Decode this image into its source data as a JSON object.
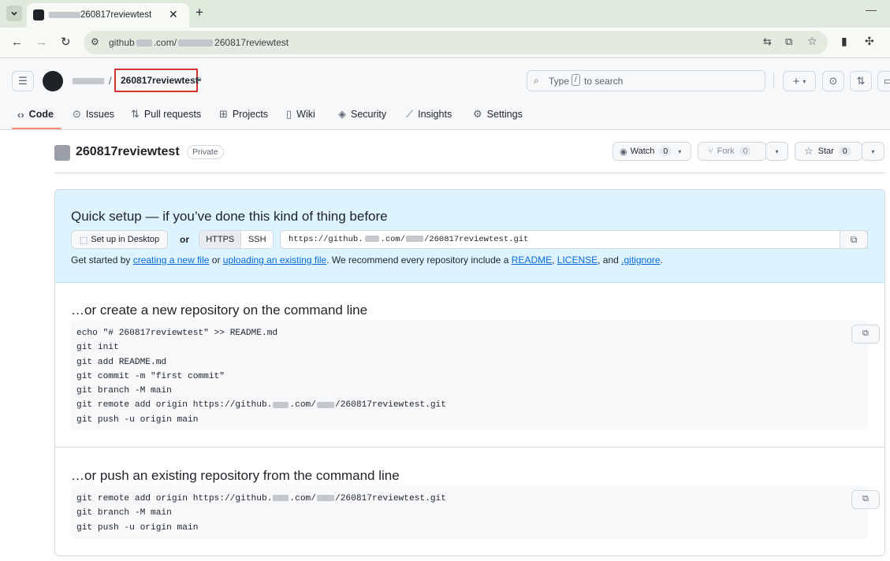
{
  "browser": {
    "tab_title": "260817reviewtest",
    "url_prefix": "github",
    "url_mid": ".com/",
    "url_suffix": "260817reviewtest"
  },
  "header": {
    "owner_sep": "/",
    "repo_name": "260817reviewtest",
    "search_prefix": "Type",
    "search_key": "/",
    "search_suffix": "to search",
    "plus": "+"
  },
  "nav": {
    "tabs": [
      {
        "label": "Code"
      },
      {
        "label": "Issues"
      },
      {
        "label": "Pull requests"
      },
      {
        "label": "Projects"
      },
      {
        "label": "Wiki"
      },
      {
        "label": "Security"
      },
      {
        "label": "Insights"
      },
      {
        "label": "Settings"
      }
    ]
  },
  "repo": {
    "name": "260817reviewtest",
    "visibility": "Private",
    "watch_label": "Watch",
    "watch_count": "0",
    "fork_label": "Fork",
    "fork_count": "0",
    "star_label": "Star",
    "star_count": "0"
  },
  "quick": {
    "title": "Quick setup — if you’ve done this kind of thing before",
    "desktop_label": "Set up in Desktop",
    "or": "or",
    "https": "HTTPS",
    "ssh": "SSH",
    "clone_prefix": "https://github.",
    "clone_mid": ".com/",
    "clone_suffix": "/260817reviewtest.git",
    "info_1": "Get started by ",
    "link_new_file": "creating a new file",
    "info_2": " or ",
    "link_upload": "uploading an existing file",
    "info_3": ". We recommend every repository include a ",
    "link_readme": "README",
    "info_4": ", ",
    "link_license": "LICENSE",
    "info_5": ", and ",
    "link_gitignore": ".gitignore",
    "info_6": "."
  },
  "create": {
    "title": "…or create a new repository on the command line",
    "lines": [
      "echo \"# 260817reviewtest\" >> README.md",
      "git init",
      "git add README.md",
      "git commit -m \"first commit\"",
      "git branch -M main"
    ],
    "remote_prefix": "git remote add origin https://github.",
    "remote_mid": ".com/",
    "remote_suffix": "/260817reviewtest.git",
    "last_line": "git push -u origin main"
  },
  "push": {
    "title": "…or push an existing repository from the command line",
    "remote_prefix": "git remote add origin https://github.",
    "remote_mid": ".com/",
    "remote_suffix": "/260817reviewtest.git",
    "lines": [
      "git branch -M main",
      "git push -u origin main"
    ]
  }
}
